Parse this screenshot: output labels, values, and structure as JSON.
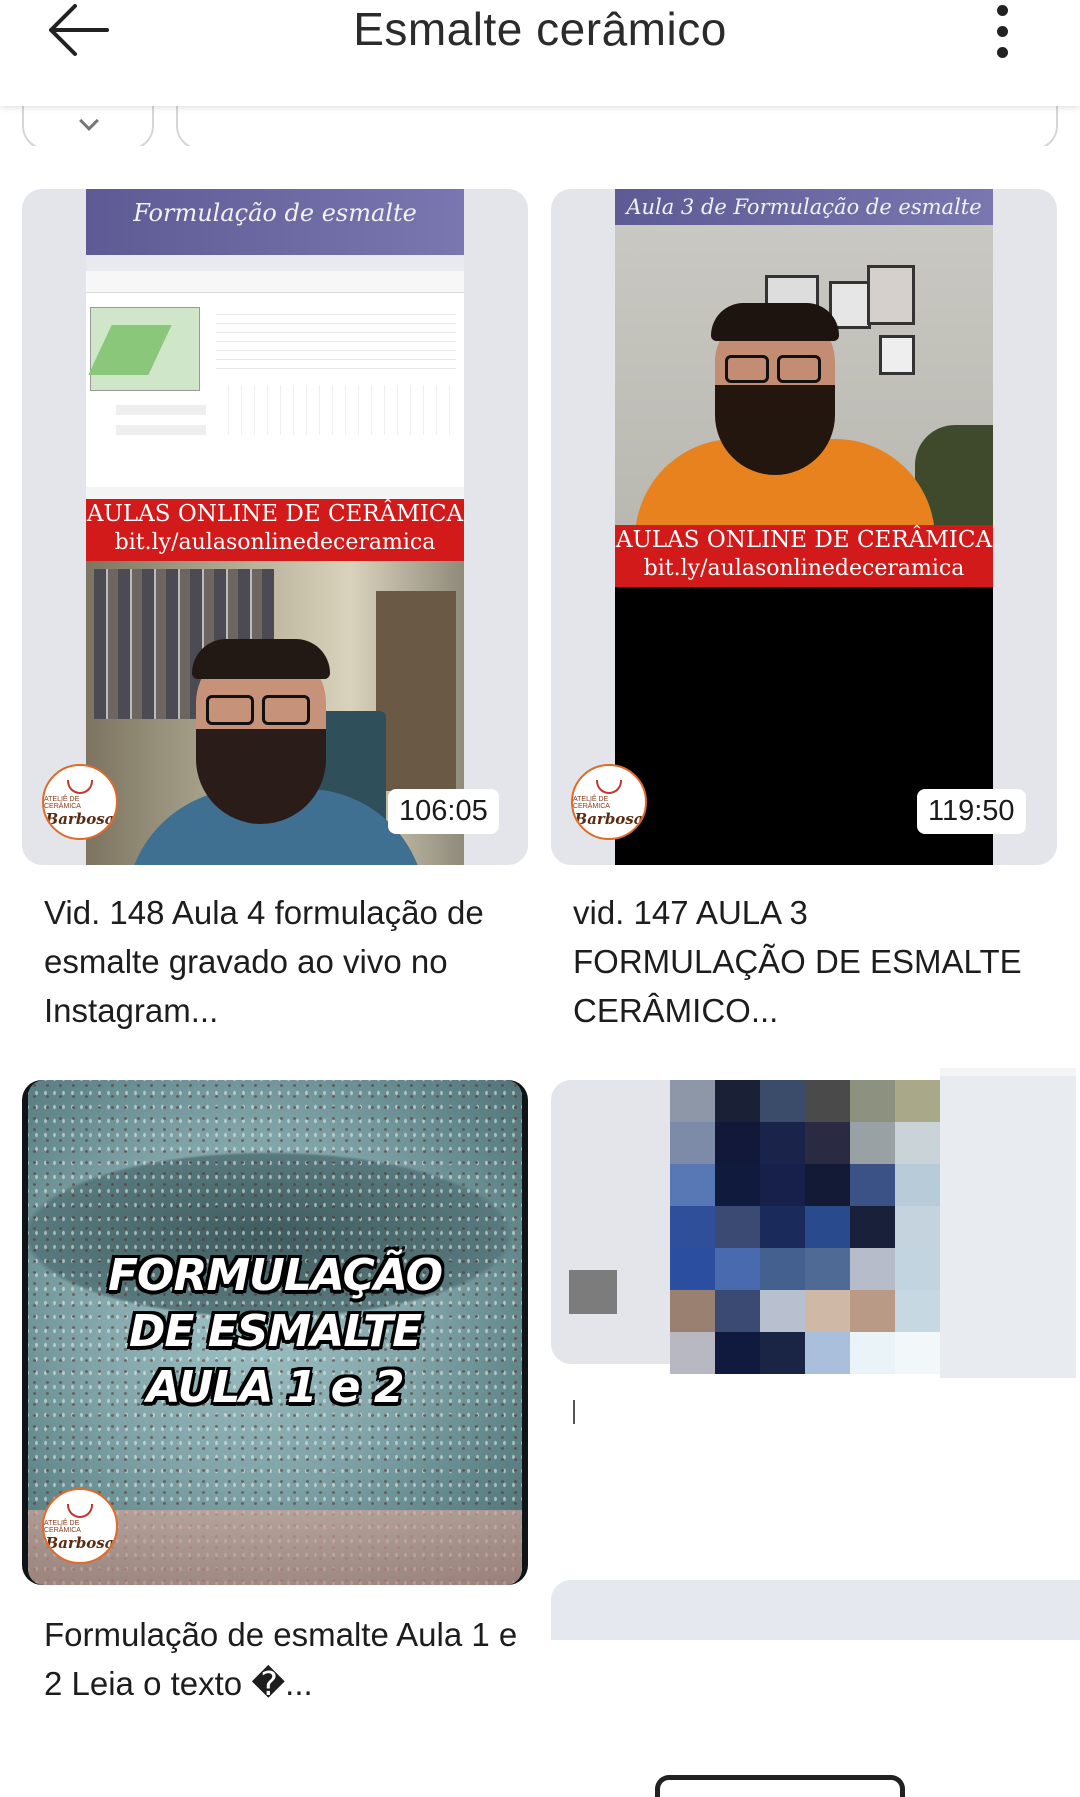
{
  "header": {
    "title": "Esmalte cerâmico",
    "back_icon": "arrow-left-icon",
    "more_icon": "more-vertical-icon"
  },
  "channel": {
    "avatar_top": "ATELIÊ DE CERÂMICA",
    "avatar_name": "Barbosa"
  },
  "videos": [
    {
      "duration": "106:05",
      "title": "Vid. 148 Aula 4 formulação de esmalte gravado ao vivo no Instagram...",
      "overlay_top": "Formulação de esmalte",
      "overlay_red_1": "AULAS ONLINE DE CERÂMICA",
      "overlay_red_2": "bit.ly/aulasonlinedeceramica"
    },
    {
      "duration": "119:50",
      "title": "vid. 147 AULA 3 FORMULAÇÃO DE ESMALTE CERÂMICO...",
      "overlay_top": "Aula 3 de Formulação de esmalte",
      "overlay_red_1": "AULAS ONLINE DE CERÂMICA",
      "overlay_red_2": "bit.ly/aulasonlinedeceramica"
    },
    {
      "duration": "",
      "title": "Formulação de esmalte Aula 1 e 2 Leia o texto �...",
      "overlay_line_1": "FORMULAÇÃO",
      "overlay_line_2": "DE ESMALTE",
      "overlay_line_3": "AULA 1 e 2"
    }
  ],
  "colors": {
    "accent_red": "#d31a1a",
    "card_bg": "#e3e5ea",
    "glaze_blue": "#7fa3a6"
  }
}
